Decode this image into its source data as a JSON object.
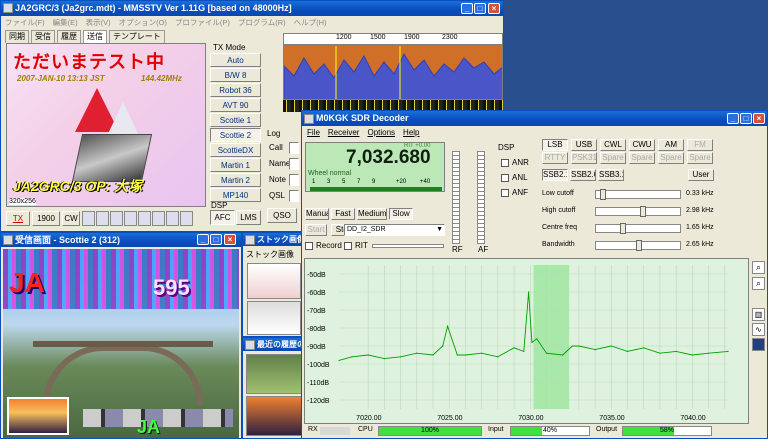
{
  "mmsstv": {
    "title": "JA2GRC/3 (Ja2grc.mdt) - MMSSTV Ver 1.11G [based on 48000Hz]",
    "menu": [
      "ファイル(F)",
      "編集(E)",
      "表示(V)",
      "オプション(O)",
      "プロファイル(P)",
      "プログラム(R)",
      "ヘルプ(H)"
    ],
    "tabs": [
      "同期",
      "受信",
      "履歴",
      "送信",
      "テンプレート"
    ],
    "tx_image": {
      "headline": "ただいまテスト中",
      "date_line": "2007-JAN-10  13:13 JST",
      "freq": "144.42MHz",
      "callsign": "JA2GRC/3  OP: 大塚",
      "size": "320x256"
    },
    "tx_mode_label": "TX Mode",
    "modes": [
      "Auto",
      "B/W 8",
      "Robot 36",
      "AVT 90",
      "Scottie 1",
      "Scottie 2",
      "ScottieDX",
      "Martin 1",
      "Martin 2",
      "MP140"
    ],
    "log_label": "Log",
    "log_fields": [
      "Call",
      "Name",
      "Note",
      "QSL"
    ],
    "dsp_label": "DSP",
    "afc": "AFC",
    "lms": "LMS",
    "qso": "QSO",
    "bottom": {
      "tx": "TX",
      "freq": "1900",
      "cw": "CW"
    },
    "spectrum_ticks": [
      "1200",
      "1500",
      "1900",
      "2300"
    ],
    "rx_window": {
      "title": "受信画面 - Scottie 2 (312)",
      "caption": "JA",
      "number": "595"
    },
    "stock_window": {
      "title": "ストック画像",
      "label": "ストック画像"
    },
    "history_window": {
      "title": "最近の履歴の..."
    }
  },
  "sdr": {
    "title": "M0KGK SDR Decoder",
    "menu": [
      "File",
      "Receiver",
      "Options",
      "Help"
    ],
    "frequency": "7,032.680",
    "rit_label": "RIT +0.00",
    "wheel_label": "Wheel normal",
    "tuning_scale": [
      "1",
      "3",
      "5",
      "7",
      "9",
      "+20",
      "+40"
    ],
    "speed_buttons": [
      "Manual",
      "Fast",
      "Medium",
      "Slow"
    ],
    "start": "Start",
    "stop": "Stop",
    "source": "DD_I2_SDR",
    "record": "Record",
    "rit": "RIT",
    "rf": "RF",
    "af": "AF",
    "dsp": "DSP",
    "anr": "ANR",
    "anl": "ANL",
    "anf": "ANF",
    "mode_buttons": [
      "LSB",
      "USB",
      "CWL",
      "CWU",
      "AM",
      "FM",
      "RTTY",
      "PSK31",
      "Spare",
      "Spare",
      "Spare",
      "Spare"
    ],
    "ssb_buttons": [
      "SSB2.1",
      "SSB2.6",
      "SSB3.1"
    ],
    "user": "User",
    "sliders": [
      {
        "label": "Low cutoff",
        "value": "0.33 kHz",
        "level": 0.05
      },
      {
        "label": "High cutoff",
        "value": "2.98 kHz",
        "level": 0.55
      },
      {
        "label": "Centre freq",
        "value": "1.65 kHz",
        "level": 0.3
      },
      {
        "label": "Bandwidth",
        "value": "2.65 kHz",
        "level": 0.5
      }
    ],
    "status": {
      "rx": "RX",
      "cpu": "CPU",
      "cpu_val": "100%",
      "input": "Input",
      "input_val": "40%",
      "output": "Output",
      "output_val": "58%"
    }
  },
  "chart_data": {
    "type": "line",
    "x_ticks": [
      "7020.00",
      "7025.00",
      "7030.00",
      "7035.00",
      "7040.00"
    ],
    "y_ticks": [
      "-50dB",
      "-60dB",
      "-70dB",
      "-80dB",
      "-90dB",
      "-100dB",
      "-110dB",
      "-120dB"
    ],
    "xlim": [
      7018.2,
      7042.2
    ],
    "ylim": [
      -125,
      -45
    ],
    "highlight_band": [
      7030.2,
      7032.4
    ],
    "grid": true,
    "series": [
      {
        "x": [
          7018.2,
          7019,
          7020,
          7021,
          7022,
          7023,
          7024,
          7024.6,
          7024.9,
          7025.5,
          7026,
          7027,
          7028,
          7029,
          7029.6,
          7029.9,
          7030.1,
          7030.4,
          7031,
          7032,
          7032.6,
          7033,
          7034,
          7035,
          7036,
          7037,
          7038,
          7039,
          7040,
          7041,
          7042.2
        ],
        "y": [
          -98,
          -96,
          -95,
          -97,
          -96,
          -94,
          -95,
          -90,
          -79,
          -95,
          -95,
          -94,
          -96,
          -91,
          -93,
          -60,
          -88,
          -86,
          -94,
          -95,
          -90,
          -90,
          -92,
          -90,
          -93,
          -91,
          -94,
          -93,
          -95,
          -94,
          -93
        ]
      }
    ]
  },
  "colors": {
    "titlebar": "#0a4fc0",
    "chart_bg": "#dff2df",
    "band": "#a8e8a8",
    "trace": "#00a000",
    "mm_spec": "#4a55c8"
  }
}
